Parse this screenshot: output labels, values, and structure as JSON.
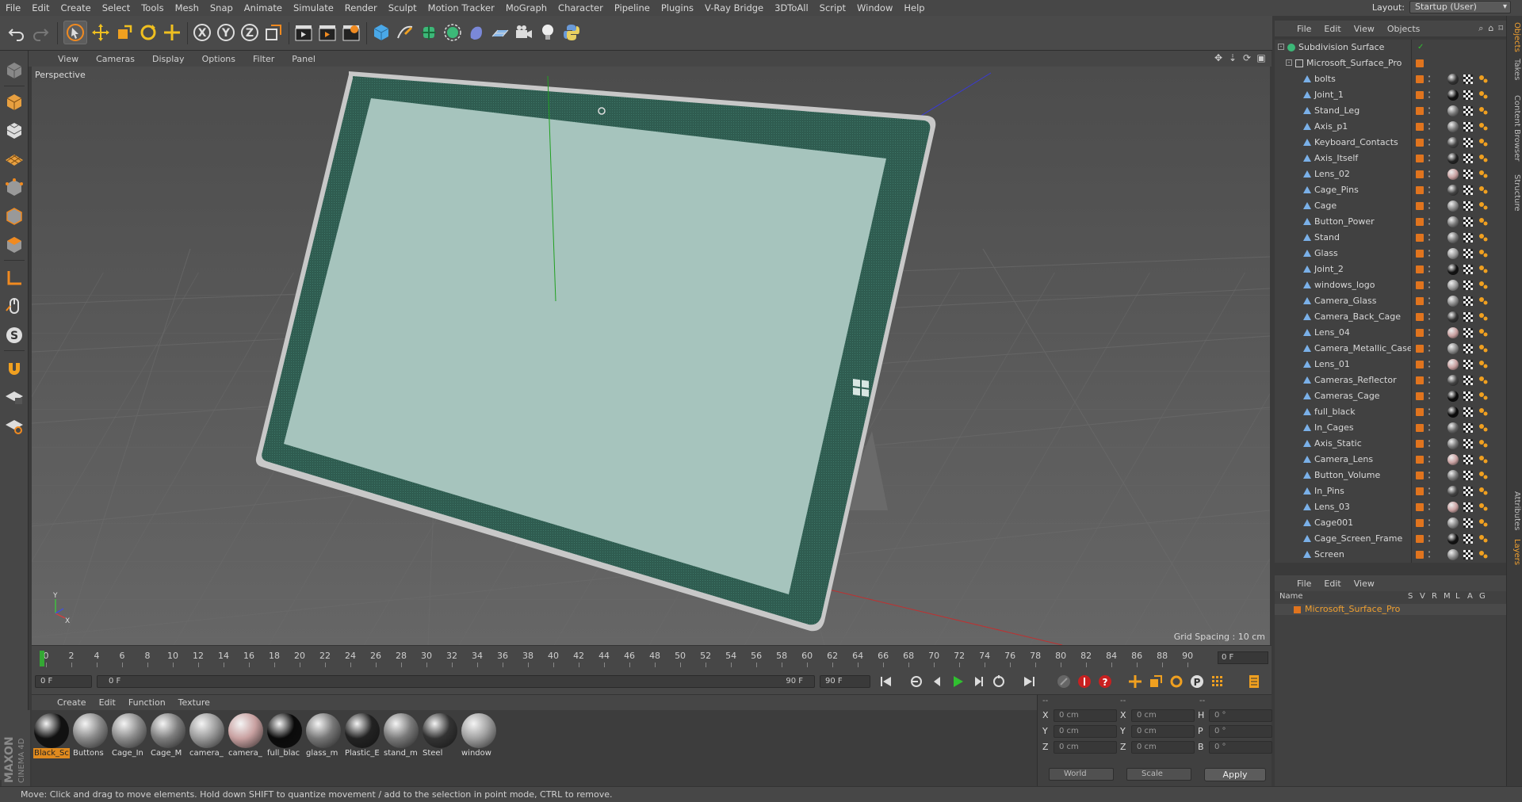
{
  "menu": [
    "File",
    "Edit",
    "Create",
    "Select",
    "Tools",
    "Mesh",
    "Snap",
    "Animate",
    "Simulate",
    "Render",
    "Sculpt",
    "Motion Tracker",
    "MoGraph",
    "Character",
    "Pipeline",
    "Plugins",
    "V-Ray Bridge",
    "3DToAll",
    "Script",
    "Window",
    "Help"
  ],
  "layout": {
    "label": "Layout:",
    "value": "Startup (User)"
  },
  "viewport": {
    "menu": [
      "View",
      "Cameras",
      "Display",
      "Options",
      "Filter",
      "Panel"
    ],
    "label": "Perspective",
    "grid_spacing": "Grid Spacing : 10 cm",
    "colors": {
      "screen": "#a6c4bd",
      "bezel": "#2f5c50",
      "frame": "#c8c8c8"
    }
  },
  "timeline": {
    "ticks": [
      "0",
      "2",
      "4",
      "6",
      "8",
      "10",
      "12",
      "14",
      "16",
      "18",
      "20",
      "22",
      "24",
      "26",
      "28",
      "30",
      "32",
      "34",
      "36",
      "38",
      "40",
      "42",
      "44",
      "46",
      "48",
      "50",
      "52",
      "54",
      "56",
      "58",
      "60",
      "62",
      "64",
      "66",
      "68",
      "70",
      "72",
      "74",
      "76",
      "78",
      "80",
      "82",
      "84",
      "86",
      "88",
      "90"
    ],
    "current_frame": "0 F"
  },
  "transport": {
    "start": "0 F",
    "range_start": "0 F",
    "range_end": "90 F",
    "end": "90 F"
  },
  "materials": {
    "menu": [
      "Create",
      "Edit",
      "Function",
      "Texture"
    ],
    "items": [
      {
        "name": "Black_Sc",
        "color": "#111111",
        "selected": true
      },
      {
        "name": "Buttons",
        "color": "#8a8a8a"
      },
      {
        "name": "Cage_In",
        "color": "#8c8c8c"
      },
      {
        "name": "Cage_M",
        "color": "#7e7e7e"
      },
      {
        "name": "camera_",
        "color": "#9a9a9a"
      },
      {
        "name": "camera_",
        "color": "#c8a0a0"
      },
      {
        "name": "full_blac",
        "color": "#0a0a0a"
      },
      {
        "name": "glass_m",
        "color": "#777777"
      },
      {
        "name": "Plastic_E",
        "color": "#222222"
      },
      {
        "name": "stand_m",
        "color": "#7a7a7a"
      },
      {
        "name": "Steel",
        "color": "#333333"
      },
      {
        "name": "window",
        "color": "#a0a0a0"
      }
    ],
    "brand_top": "MAXON",
    "brand_bottom": "CINEMA 4D"
  },
  "coords": {
    "headers": [
      "--",
      "--",
      "--"
    ],
    "rows": [
      {
        "a": "X",
        "av": "0 cm",
        "b": "X",
        "bv": "0 cm",
        "c": "H",
        "cv": "0 °"
      },
      {
        "a": "Y",
        "av": "0 cm",
        "b": "Y",
        "bv": "0 cm",
        "c": "P",
        "cv": "0 °"
      },
      {
        "a": "Z",
        "av": "0 cm",
        "b": "Z",
        "bv": "0 cm",
        "c": "B",
        "cv": "0 °"
      }
    ],
    "space": "World",
    "mode": "Scale",
    "apply": "Apply"
  },
  "status": "Move: Click and drag to move elements. Hold down SHIFT to quantize movement / add to the selection in point mode, CTRL to remove.",
  "object_manager": {
    "menu": [
      "File",
      "Edit",
      "View",
      "Objects"
    ],
    "root": "Subdivision Surface",
    "group": "Microsoft_Surface_Pro",
    "objects": [
      {
        "name": "bolts",
        "mat": "#333"
      },
      {
        "name": "Joint_1",
        "mat": "#111"
      },
      {
        "name": "Stand_Leg",
        "mat": "#777"
      },
      {
        "name": "Axis_p1",
        "mat": "#777"
      },
      {
        "name": "Keyboard_Contacts",
        "mat": "#444"
      },
      {
        "name": "Axis_Itself",
        "mat": "#222"
      },
      {
        "name": "Lens_02",
        "mat": "#c8a0a0"
      },
      {
        "name": "Cage_Pins",
        "mat": "#444"
      },
      {
        "name": "Cage",
        "mat": "#888"
      },
      {
        "name": "Button_Power",
        "mat": "#777"
      },
      {
        "name": "Stand",
        "mat": "#777"
      },
      {
        "name": "Glass",
        "mat": "#999"
      },
      {
        "name": "Joint_2",
        "mat": "#111"
      },
      {
        "name": "windows_logo",
        "mat": "#999"
      },
      {
        "name": "Camera_Glass",
        "mat": "#888"
      },
      {
        "name": "Camera_Back_Cage",
        "mat": "#333"
      },
      {
        "name": "Lens_04",
        "mat": "#c8a0a0"
      },
      {
        "name": "Camera_Metallic_Case",
        "mat": "#888"
      },
      {
        "name": "Lens_01",
        "mat": "#c8a0a0"
      },
      {
        "name": "Cameras_Reflector",
        "mat": "#444"
      },
      {
        "name": "Cameras_Cage",
        "mat": "#0a0a0a"
      },
      {
        "name": "full_black",
        "mat": "#0a0a0a"
      },
      {
        "name": "In_Cages",
        "mat": "#666"
      },
      {
        "name": "Axis_Static",
        "mat": "#777"
      },
      {
        "name": "Camera_Lens",
        "mat": "#c8a0a0"
      },
      {
        "name": "Button_Volume",
        "mat": "#777"
      },
      {
        "name": "In_Pins",
        "mat": "#444"
      },
      {
        "name": "Lens_03",
        "mat": "#c8a0a0"
      },
      {
        "name": "Cage001",
        "mat": "#888"
      },
      {
        "name": "Cage_Screen_Frame",
        "mat": "#111"
      },
      {
        "name": "Screen",
        "mat": "#888"
      }
    ]
  },
  "layer_manager": {
    "menu": [
      "File",
      "Edit",
      "View"
    ],
    "header": "Name",
    "cols": [
      "S",
      "V",
      "R",
      "M",
      "L",
      "A",
      "G"
    ],
    "layer": "Microsoft_Surface_Pro"
  },
  "side_tabs": [
    "Objects",
    "Takes",
    "Content Browser",
    "Structure",
    "Attributes",
    "Layers"
  ]
}
